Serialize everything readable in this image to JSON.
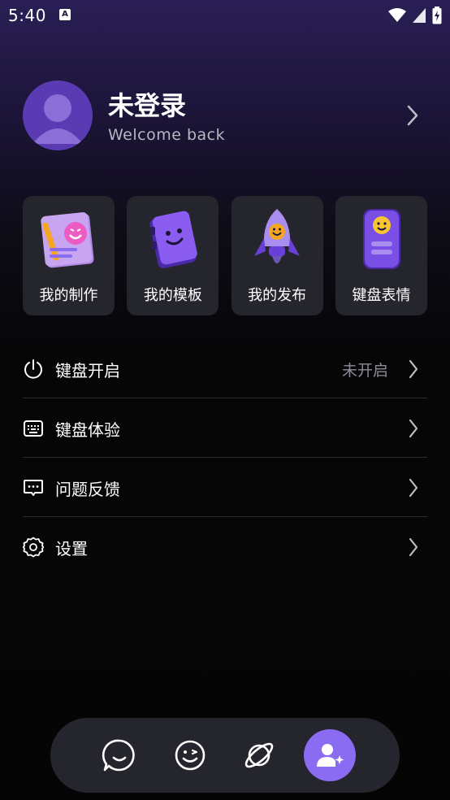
{
  "status_bar": {
    "time": "5:40",
    "notification_letter": "A"
  },
  "profile": {
    "name": "未登录",
    "subtitle": "Welcome back"
  },
  "cards": [
    {
      "label": "我的制作",
      "icon": "notebook-emoji-icon"
    },
    {
      "label": "我的模板",
      "icon": "book-smile-icon"
    },
    {
      "label": "我的发布",
      "icon": "rocket-icon"
    },
    {
      "label": "键盘表情",
      "icon": "phone-emoji-icon"
    }
  ],
  "menu": [
    {
      "label": "键盘开启",
      "value": "未开启",
      "icon": "power-icon"
    },
    {
      "label": "键盘体验",
      "value": "",
      "icon": "keyboard-icon"
    },
    {
      "label": "问题反馈",
      "value": "",
      "icon": "feedback-icon"
    },
    {
      "label": "设置",
      "value": "",
      "icon": "gear-icon"
    }
  ],
  "bottom_nav": [
    {
      "name": "chat-smile-icon",
      "active": false
    },
    {
      "name": "wink-face-icon",
      "active": false
    },
    {
      "name": "planet-icon",
      "active": false
    },
    {
      "name": "user-add-icon",
      "active": true
    }
  ],
  "colors": {
    "accent": "#8a6cf2",
    "card_bg": "#25252d",
    "muted_text": "#8d8b96"
  }
}
